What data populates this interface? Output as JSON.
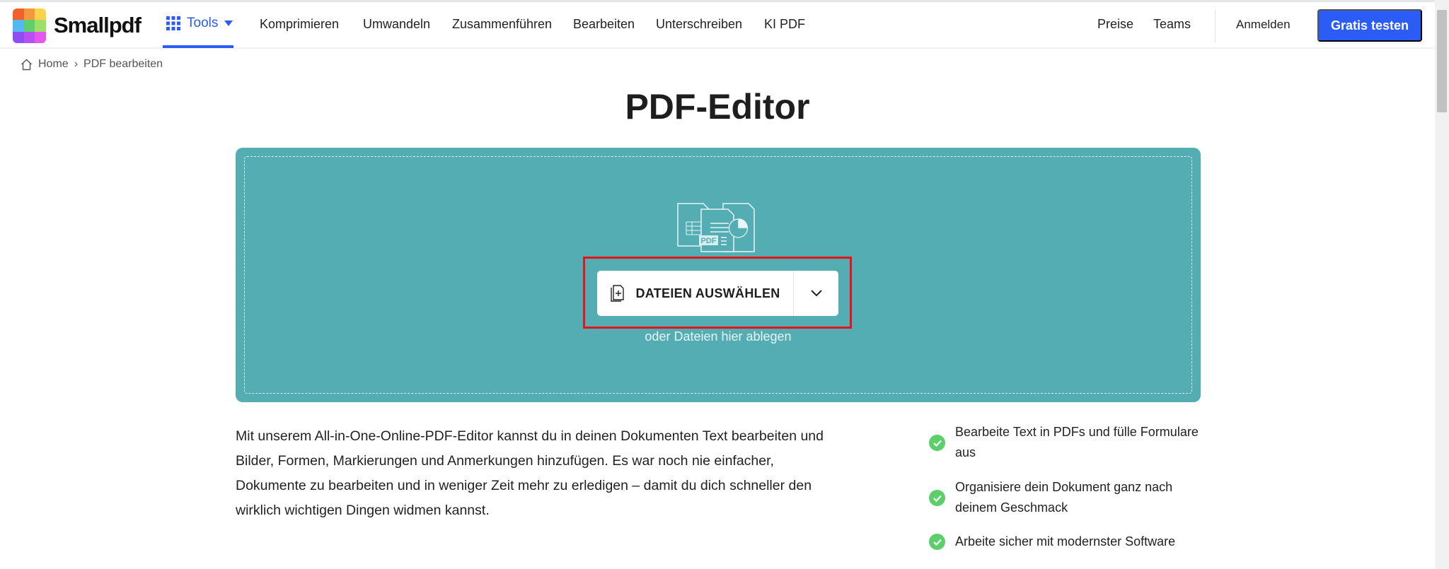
{
  "header": {
    "brand": "Smallpdf",
    "tools_label": "Tools",
    "nav": [
      "Komprimieren",
      "Umwandeln",
      "Zusammenführen",
      "Bearbeiten",
      "Unterschreiben",
      "KI PDF"
    ],
    "preise": "Preise",
    "teams": "Teams",
    "login": "Anmelden",
    "cta": "Gratis testen",
    "accent": "#2b5cf6"
  },
  "breadcrumb": {
    "home": "Home",
    "separator": "›",
    "current": "PDF bearbeiten"
  },
  "title": "PDF-Editor",
  "upload": {
    "icon_badge": "PDF",
    "button": "DATEIEN AUSWÄHLEN",
    "hint": "oder Dateien hier ablegen",
    "bg": "#53adb3"
  },
  "description": "Mit unserem All-in-One-Online-PDF-Editor kannst du in deinen Dokumenten Text bearbeiten und Bilder, Formen, Markierungen und Anmerkungen hinzufügen. Es war noch nie einfacher, Dokumente zu bearbeiten und in weniger Zeit mehr zu erledigen – damit du dich schneller den wirklich wichtigen Dingen widmen kannst.",
  "features": [
    "Bearbeite Text in PDFs und fülle Formulare aus",
    "Organisiere dein Dokument ganz nach deinem Geschmack",
    "Arbeite sicher mit modernster Software"
  ]
}
